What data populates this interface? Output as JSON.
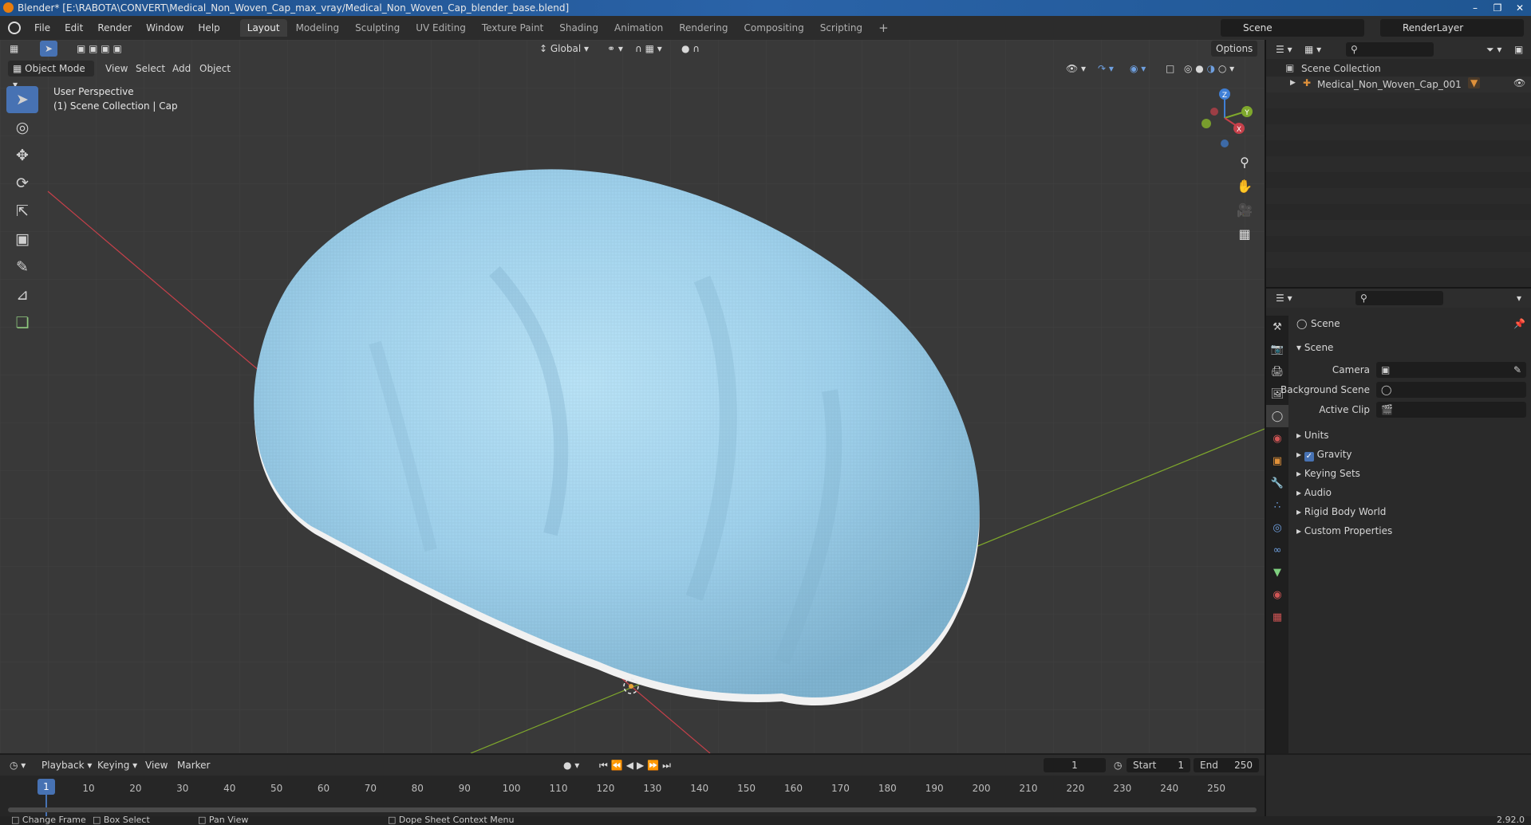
{
  "window": {
    "title": "Blender* [E:\\RABOTA\\CONVERT\\Medical_Non_Woven_Cap_max_vray/Medical_Non_Woven_Cap_blender_base.blend]"
  },
  "menu": [
    "File",
    "Edit",
    "Render",
    "Window",
    "Help"
  ],
  "workspaces": [
    "Layout",
    "Modeling",
    "Sculpting",
    "UV Editing",
    "Texture Paint",
    "Shading",
    "Animation",
    "Rendering",
    "Compositing",
    "Scripting"
  ],
  "scene_name": "Scene",
  "render_layer": "RenderLayer",
  "viewport": {
    "mode": "Object Mode",
    "menus": [
      "View",
      "Select",
      "Add",
      "Object"
    ],
    "transform_orientation": "Global",
    "options_label": "Options",
    "overlay_line1": "User Perspective",
    "overlay_line2": "(1) Scene Collection | Cap",
    "gizmo": {
      "x": "X",
      "y": "Y",
      "z": "Z"
    }
  },
  "outliner": {
    "root": "Scene Collection",
    "items": [
      {
        "name": "Medical_Non_Woven_Cap_001"
      }
    ]
  },
  "properties": {
    "header": "Scene",
    "panel": "Scene",
    "fields": [
      {
        "label": "Camera"
      },
      {
        "label": "Background Scene"
      },
      {
        "label": "Active Clip"
      }
    ],
    "sections": [
      "Units",
      "Gravity",
      "Keying Sets",
      "Audio",
      "Rigid Body World",
      "Custom Properties"
    ],
    "gravity_checked": true
  },
  "timeline": {
    "menus": [
      "Playback",
      "Keying",
      "View",
      "Marker"
    ],
    "current_frame": "1",
    "start_label": "Start",
    "start": "1",
    "end_label": "End",
    "end": "250",
    "ticks": [
      "1",
      "10",
      "20",
      "30",
      "40",
      "50",
      "60",
      "70",
      "80",
      "90",
      "100",
      "110",
      "120",
      "130",
      "140",
      "150",
      "160",
      "170",
      "180",
      "190",
      "200",
      "210",
      "220",
      "230",
      "240",
      "250"
    ]
  },
  "status": {
    "items": [
      "Change Frame",
      "Box Select",
      "Pan View",
      "Dope Sheet Context Menu"
    ],
    "version": "2.92.0"
  },
  "colors": {
    "accent": "#4772b3",
    "cap": "#a9d8f2",
    "x_axis": "#c6404a",
    "y_axis": "#7fa82c",
    "z_axis": "#3f7fd6"
  }
}
